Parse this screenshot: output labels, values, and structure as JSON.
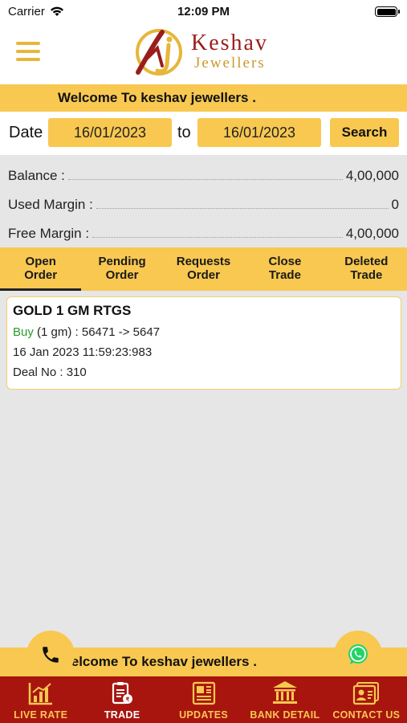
{
  "status_bar": {
    "carrier": "Carrier",
    "time": "12:09 PM"
  },
  "header": {
    "logo_text_1": "Keshav",
    "logo_text_2": "Jewellers",
    "welcome": "Welcome To keshav jewellers ."
  },
  "date_filter": {
    "date_label": "Date",
    "from_date": "16/01/2023",
    "to_label": "to",
    "to_date": "16/01/2023",
    "search_label": "Search"
  },
  "balance": {
    "balance_label": "Balance :",
    "balance_value": "4,00,000",
    "used_margin_label": "Used Margin :",
    "used_margin_value": "0",
    "free_margin_label": "Free Margin :",
    "free_margin_value": "4,00,000"
  },
  "tabs": [
    {
      "line1": "Open",
      "line2": "Order",
      "active": true
    },
    {
      "line1": "Pending",
      "line2": "Order",
      "active": false
    },
    {
      "line1": "Requests",
      "line2": "Order",
      "active": false
    },
    {
      "line1": "Close",
      "line2": "Trade",
      "active": false
    },
    {
      "line1": "Deleted",
      "line2": "Trade",
      "active": false
    }
  ],
  "orders": [
    {
      "title": "GOLD 1 GM RTGS",
      "side": "Buy",
      "detail": " (1 gm) : 56471 -> 5647",
      "timestamp": "16 Jan 2023 11:59:23:983",
      "deal": "Deal No : 310"
    }
  ],
  "footer": {
    "welcome": "Welcome To keshav jewellers ."
  },
  "bottom_nav": [
    {
      "label": "LIVE RATE",
      "icon": "chart-icon"
    },
    {
      "label": "TRADE",
      "icon": "trade-icon",
      "active": true
    },
    {
      "label": "UPDATES",
      "icon": "newspaper-icon"
    },
    {
      "label": "BANK DETAIL",
      "icon": "bank-icon"
    },
    {
      "label": "CONTACT US",
      "icon": "contact-card-icon"
    }
  ],
  "colors": {
    "accent": "#f8c850",
    "nav_bg": "#a8150f",
    "buy": "#2b9a2b"
  }
}
